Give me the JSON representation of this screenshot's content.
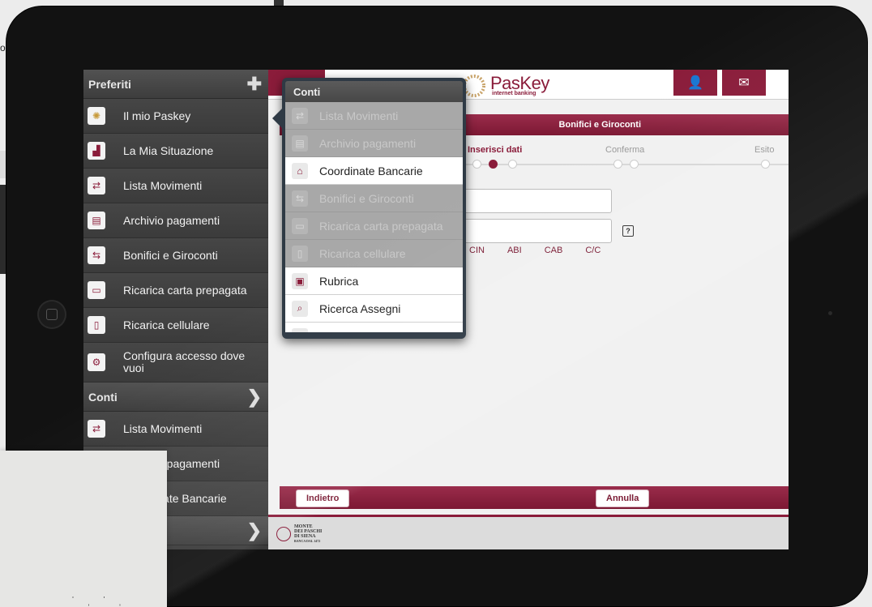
{
  "background": {
    "edge_text": "or"
  },
  "sidebar": {
    "favorites_header": "Preferiti",
    "favorites": [
      {
        "label": "Il mio Paskey",
        "icon": "spiral-icon"
      },
      {
        "label": "La Mia Situazione",
        "icon": "bar-chart-icon"
      },
      {
        "label": "Lista Movimenti",
        "icon": "arrows-icon"
      },
      {
        "label": "Archivio pagamenti",
        "icon": "archive-icon"
      },
      {
        "label": "Bonifici e Giroconti",
        "icon": "transfer-icon"
      },
      {
        "label": "Ricarica carta prepagata",
        "icon": "card-icon"
      },
      {
        "label": "Ricarica cellulare",
        "icon": "phone-icon"
      },
      {
        "label": "Configura accesso dove vuoi",
        "icon": "gear-card-icon"
      }
    ],
    "conti_header": "Conti",
    "conti": [
      {
        "label": "Lista Movimenti",
        "icon": "arrows-icon"
      },
      {
        "label": "Archivio pagamenti",
        "icon": "archive-icon"
      },
      {
        "label": "Coordinate Bancarie",
        "icon": "bank-icon"
      }
    ]
  },
  "app": {
    "logo_title": "PasKey",
    "logo_subtitle": "internet banking",
    "section_title": "Bonifici e Giroconti",
    "steps": [
      "Inserisci dati",
      "Conferma",
      "Esito"
    ],
    "help_glyph": "?",
    "iban_parts": [
      "CIN",
      "ABI",
      "CAB",
      "C/C"
    ],
    "back_button": "Indietro",
    "cancel_button": "Annulla",
    "footer_bank": [
      "MONTE",
      "DEI PASCHI",
      "DI SIENA",
      "BANCA DAL 1472"
    ]
  },
  "popover": {
    "title": "Conti",
    "items": [
      {
        "label": "Lista Movimenti",
        "enabled": false,
        "icon": "arrows-icon"
      },
      {
        "label": "Archivio pagamenti",
        "enabled": false,
        "icon": "archive-icon"
      },
      {
        "label": "Coordinate Bancarie",
        "enabled": true,
        "icon": "bank-icon"
      },
      {
        "label": "Bonifici e Giroconti",
        "enabled": false,
        "icon": "transfer-icon"
      },
      {
        "label": "Ricarica carta prepagata",
        "enabled": false,
        "icon": "card-icon"
      },
      {
        "label": "Ricarica cellulare",
        "enabled": false,
        "icon": "phone-icon"
      },
      {
        "label": "Rubrica",
        "enabled": true,
        "icon": "address-book-icon"
      },
      {
        "label": "Ricerca Assegni",
        "enabled": true,
        "icon": "check-search-icon"
      }
    ]
  },
  "colors": {
    "brand": "#8a1c3a",
    "sidebar": "#3a3a3a"
  }
}
